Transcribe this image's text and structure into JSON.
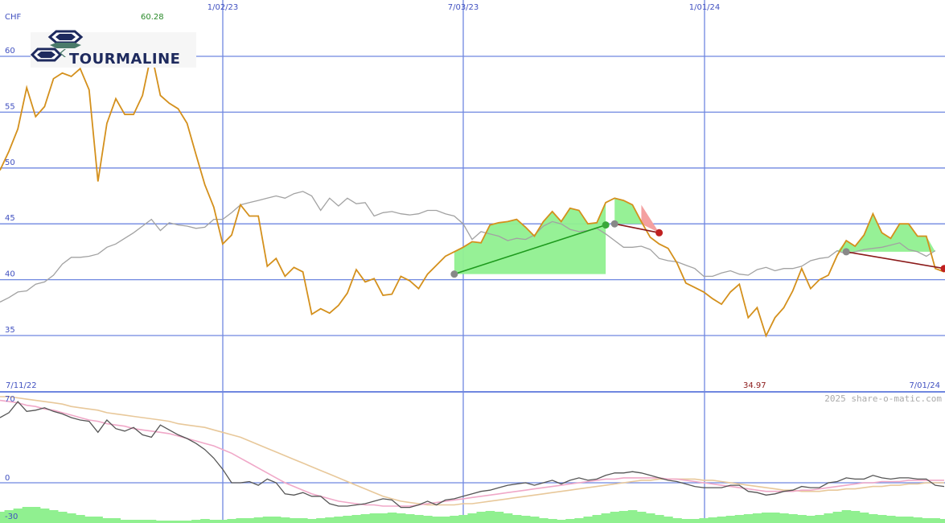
{
  "logo": {
    "text": "TOURMALINE"
  },
  "currency": "CHF",
  "watermark": "2025 share-o-matic.com",
  "colors": {
    "grid": "#6f87e0",
    "price": "#d4901c",
    "benchmark": "#a2a2a2",
    "fill_up": "#90f090",
    "fill_down": "#f4a0a0",
    "trend_up": "#1d9a1d",
    "trend_down": "#8b1a1a",
    "osc_main": "#555555",
    "osc_fast": "#f0a8c8",
    "osc_slow": "#e8c89a",
    "volume": "#90f090",
    "label_blue": "#4050c0",
    "label_green": "#2a8a2a",
    "label_red": "#8b1a1a",
    "logo_dark": "#1e2a5e",
    "logo_green": "#4a7a6a"
  },
  "top_labels": {
    "high": "60.28",
    "low": "34.97",
    "start_date": "7/11/22",
    "end_date": "7/01/24"
  },
  "chart_data": [
    {
      "type": "line",
      "title": "",
      "ylabel": "CHF",
      "x_ticks": [
        "1/02/23",
        "7/03/23",
        "1/01/24"
      ],
      "y_ticks": [
        "35",
        "40",
        "45",
        "50",
        "55",
        "60"
      ],
      "ylim": [
        33.5,
        64
      ],
      "grid": true,
      "series": [
        {
          "values": [
            49.8,
            51.5,
            53.5,
            57.2,
            54.6,
            55.5,
            58.0,
            58.5,
            58.2,
            58.9,
            57.0,
            48.8,
            54.0,
            56.2,
            54.8,
            54.8,
            56.5,
            60.28,
            56.5,
            55.8,
            55.3,
            54.0,
            51.2,
            48.5,
            46.5,
            43.2,
            44.0,
            46.7,
            45.7,
            45.7,
            41.2,
            41.9,
            40.3,
            41.1,
            40.7,
            36.9,
            37.4,
            37.0,
            37.7,
            38.8,
            40.9,
            39.8,
            40.1,
            38.6,
            38.7,
            40.3,
            39.9,
            39.2,
            40.5,
            41.3,
            42.1,
            42.5,
            42.9,
            43.4,
            43.3,
            44.9,
            45.1,
            45.2,
            45.4,
            44.7,
            43.9,
            45.2,
            46.1,
            45.2,
            46.4,
            46.2,
            45.0,
            45.1,
            46.9,
            47.3,
            47.1,
            46.7,
            45.2,
            43.8,
            43.2,
            42.8,
            41.5,
            39.7,
            39.3,
            38.9,
            38.3,
            37.8,
            38.9,
            39.6,
            36.6,
            37.5,
            34.97,
            36.6,
            37.5,
            39.0,
            41.0,
            39.2,
            40.0,
            40.4,
            42.2,
            43.5,
            43.0,
            44.0,
            45.9,
            44.2,
            43.7,
            45.0,
            45.0,
            43.9,
            43.9,
            41.0,
            40.7
          ]
        },
        {
          "values": [
            38.0,
            38.4,
            38.9,
            39.0,
            39.6,
            39.8,
            40.4,
            41.4,
            42.0,
            42.0,
            42.1,
            42.3,
            42.9,
            43.2,
            43.7,
            44.2,
            44.8,
            45.4,
            44.4,
            45.1,
            44.9,
            44.8,
            44.6,
            44.7,
            45.4,
            45.4,
            46.0,
            46.7,
            46.9,
            47.1,
            47.3,
            47.5,
            47.3,
            47.7,
            47.9,
            47.5,
            46.2,
            47.3,
            46.6,
            47.3,
            46.8,
            46.9,
            45.7,
            46.0,
            46.1,
            45.9,
            45.8,
            45.9,
            46.2,
            46.2,
            45.9,
            45.7,
            45.0,
            43.6,
            44.3,
            44.1,
            43.9,
            43.5,
            43.7,
            43.6,
            44.0,
            44.8,
            45.2,
            45.0,
            44.5,
            44.3,
            44.4,
            44.6,
            44.1,
            43.5,
            42.9,
            42.9,
            43.0,
            42.7,
            41.9,
            41.7,
            41.6,
            41.3,
            41.0,
            40.3,
            40.3,
            40.6,
            40.8,
            40.5,
            40.4,
            40.9,
            41.1,
            40.8,
            41.0,
            41.0,
            41.2,
            41.7,
            41.9,
            42.0,
            42.6,
            42.3,
            42.5,
            42.7,
            42.8,
            42.9,
            43.1,
            43.3,
            42.7,
            42.5,
            42.1,
            42.6
          ]
        }
      ]
    },
    {
      "type": "line",
      "title": "",
      "y_ticks": [
        "70",
        "0",
        "-30"
      ],
      "ylim": [
        -30,
        70
      ],
      "grid": true,
      "series": [
        {
          "values": [
            53,
            57,
            66,
            58,
            59,
            61,
            58,
            56,
            53,
            51,
            50,
            41,
            51,
            44,
            42,
            45,
            39,
            37,
            47,
            43,
            39,
            36,
            32,
            27,
            20,
            11,
            0,
            0,
            1,
            -2,
            3,
            0,
            -9,
            -10,
            -8,
            -11,
            -11,
            -17,
            -19,
            -19,
            -18,
            -17,
            -15,
            -13,
            -14,
            -20,
            -20,
            -18,
            -15,
            -18,
            -14,
            -13,
            -11,
            -9,
            -7,
            -6,
            -4,
            -2,
            -1,
            0,
            -2,
            0,
            2,
            -1,
            2,
            4,
            2,
            3,
            6,
            8,
            8,
            9,
            8,
            6,
            4,
            2,
            1,
            -1,
            -3,
            -4,
            -4,
            -4,
            -2,
            -2,
            -7,
            -8,
            -10,
            -9,
            -7,
            -6,
            -3,
            -4,
            -4,
            0,
            1,
            4,
            3,
            3,
            6,
            4,
            3,
            4,
            4,
            3,
            3,
            -2,
            -3
          ]
        },
        {
          "values": [
            67,
            66,
            65,
            63,
            62,
            60,
            59,
            57,
            55,
            53,
            51,
            50,
            48,
            47,
            46,
            44,
            43,
            42,
            41,
            40,
            38,
            36,
            34,
            32,
            30,
            27,
            24,
            20,
            16,
            12,
            8,
            4,
            0,
            -3,
            -6,
            -9,
            -11,
            -13,
            -15,
            -16,
            -17,
            -18,
            -18,
            -19,
            -19,
            -19,
            -19,
            -18,
            -17,
            -16,
            -15,
            -14,
            -13,
            -12,
            -11,
            -10,
            -9,
            -8,
            -7,
            -6,
            -5,
            -4,
            -3,
            -2,
            -1,
            0,
            1,
            2,
            3,
            3,
            4,
            4,
            4,
            4,
            4,
            3,
            3,
            2,
            1,
            0,
            -1,
            -2,
            -3,
            -4,
            -5,
            -6,
            -7,
            -7,
            -7,
            -7,
            -6,
            -6,
            -5,
            -4,
            -3,
            -2,
            -1,
            0,
            0,
            1,
            1,
            1,
            2,
            2,
            2,
            2,
            2
          ]
        },
        {
          "values": [
            70,
            70,
            69,
            68,
            67,
            66,
            65,
            64,
            62,
            61,
            60,
            59,
            57,
            56,
            55,
            54,
            53,
            52,
            51,
            50,
            48,
            47,
            46,
            45,
            43,
            41,
            39,
            37,
            34,
            31,
            28,
            25,
            22,
            19,
            16,
            13,
            10,
            7,
            4,
            1,
            -2,
            -5,
            -8,
            -11,
            -13,
            -15,
            -16,
            -17,
            -18,
            -18,
            -18,
            -18,
            -17,
            -17,
            -16,
            -15,
            -14,
            -13,
            -12,
            -11,
            -10,
            -9,
            -8,
            -7,
            -6,
            -5,
            -4,
            -3,
            -2,
            -1,
            0,
            1,
            2,
            2,
            3,
            3,
            3,
            3,
            3,
            2,
            2,
            1,
            0,
            -1,
            -2,
            -3,
            -4,
            -5,
            -6,
            -6,
            -7,
            -7,
            -7,
            -6,
            -6,
            -5,
            -5,
            -4,
            -3,
            -3,
            -2,
            -2,
            -1,
            -1,
            0,
            0,
            0
          ]
        }
      ]
    }
  ]
}
